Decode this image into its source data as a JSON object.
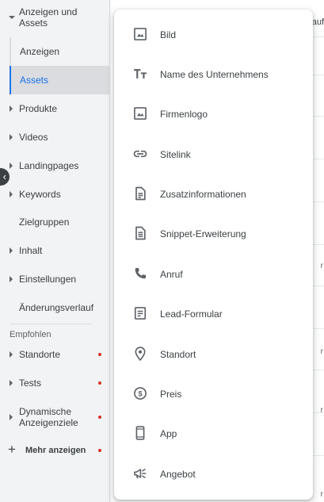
{
  "sidebar": {
    "anzeigen_assets": "Anzeigen und Assets",
    "sub_anzeigen": "Anzeigen",
    "sub_assets": "Assets",
    "items": [
      "Produkte",
      "Videos",
      "Landingpages",
      "Keywords",
      "Zielgruppen",
      "Inhalt",
      "Einstellungen",
      "Änderungsverlauf"
    ],
    "section_title": "Empfohlen",
    "recommended": [
      "Standorte",
      "Tests",
      "Dynamische Anzeigenziele"
    ],
    "more_label": "Mehr anzeigen"
  },
  "background": {
    "header_fragment": "auf",
    "fragments": [
      "r",
      "r",
      "r",
      "r"
    ]
  },
  "menu": {
    "items": [
      {
        "label": "Bild",
        "icon": "image-icon"
      },
      {
        "label": "Name des Unternehmens",
        "icon": "text-icon"
      },
      {
        "label": "Firmenlogo",
        "icon": "image-icon"
      },
      {
        "label": "Sitelink",
        "icon": "link-icon"
      },
      {
        "label": "Zusatzinformationen",
        "icon": "document-icon"
      },
      {
        "label": "Snippet-Erweiterung",
        "icon": "snippet-icon"
      },
      {
        "label": "Anruf",
        "icon": "phone-icon"
      },
      {
        "label": "Lead-Formular",
        "icon": "form-icon"
      },
      {
        "label": "Standort",
        "icon": "location-icon"
      },
      {
        "label": "Preis",
        "icon": "price-icon"
      },
      {
        "label": "App",
        "icon": "phone-device-icon"
      },
      {
        "label": "Angebot",
        "icon": "promotion-icon"
      }
    ]
  },
  "colors": {
    "accent": "#1a73e8",
    "notification_dot": "#d93025",
    "icon": "#5f6368"
  }
}
